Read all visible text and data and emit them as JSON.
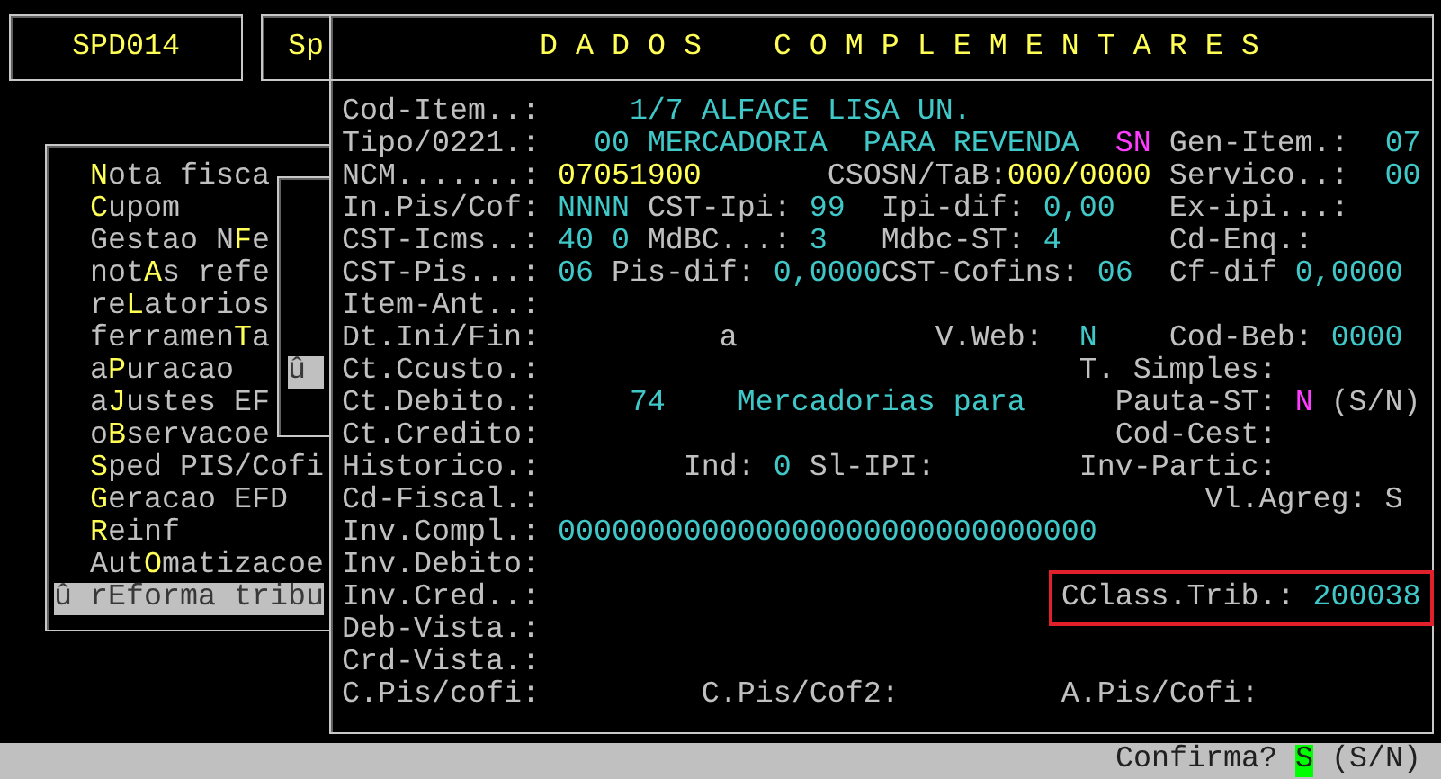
{
  "tabs": [
    {
      "label": "SPD014"
    },
    {
      "label": "Sp"
    }
  ],
  "menu": {
    "items": [
      {
        "hotkey": "N",
        "after": "ota fisca",
        "selected": false
      },
      {
        "hotkey": "C",
        "after": "upom",
        "selected": false
      },
      {
        "hotkey_before": "Gestao N",
        "hotkey": "F",
        "after": "e",
        "selected": false
      },
      {
        "hotkey_before": "not",
        "hotkey": "A",
        "after": "s refe",
        "selected": false
      },
      {
        "hotkey_before": "re",
        "hotkey": "L",
        "after": "atorios",
        "selected": false
      },
      {
        "hotkey_before": "ferramen",
        "hotkey": "T",
        "after": "a",
        "selected": false
      },
      {
        "hotkey_before": "a",
        "hotkey": "P",
        "after": "uracao",
        "selected": false
      },
      {
        "hotkey_before": "a",
        "hotkey": "J",
        "after": "ustes EF",
        "selected": false
      },
      {
        "hotkey_before": "o",
        "hotkey": "B",
        "after": "servacoe",
        "selected": false
      },
      {
        "hotkey": "S",
        "after": "ped PIS/Cofi",
        "selected": false
      },
      {
        "hotkey": "G",
        "after": "eracao EFD",
        "selected": false
      },
      {
        "hotkey": "R",
        "after": "einf",
        "selected": false
      },
      {
        "hotkey_before": "Aut",
        "hotkey": "O",
        "after": "matizacoe",
        "selected": false
      },
      {
        "marker": "û",
        "hotkey_before": "r",
        "hotkey": "E",
        "after": "forma tribu",
        "selected": true
      }
    ]
  },
  "submenu": {
    "marker": "û"
  },
  "dialog": {
    "title": "D A D O S    C O M P L E M E N T A R E S",
    "lines": [
      {
        "segments": [
          {
            "text": "Cod-Item..:",
            "color": "#c0c0c0"
          },
          {
            "text": "     1/7 ALFACE LISA UN.",
            "color": "#40c8c8"
          }
        ]
      },
      {
        "segments": [
          {
            "text": "Tipo/0221.:",
            "color": "#c0c0c0"
          },
          {
            "text": "   00 MERCADORIA  PARA REVENDA",
            "color": "#40c8c8"
          },
          {
            "text": "  SN",
            "color": "#ff3cff"
          },
          {
            "text": " Gen-Item.:",
            "color": "#c0c0c0"
          },
          {
            "text": "  07",
            "color": "#40c8c8"
          }
        ]
      },
      {
        "segments": [
          {
            "text": "NCM.......:",
            "color": "#c0c0c0"
          },
          {
            "text": " 07051900",
            "color": "#ffff55"
          },
          {
            "text": "       CSOSN/TaB:",
            "color": "#c0c0c0"
          },
          {
            "text": "000/0000",
            "color": "#ffff55"
          },
          {
            "text": " Servico..:",
            "color": "#c0c0c0"
          },
          {
            "text": "  00",
            "color": "#40c8c8"
          }
        ]
      },
      {
        "segments": [
          {
            "text": "In.Pis/Cof:",
            "color": "#c0c0c0"
          },
          {
            "text": " NNNN",
            "color": "#40c8c8"
          },
          {
            "text": " CST-Ipi:",
            "color": "#c0c0c0"
          },
          {
            "text": " 99",
            "color": "#40c8c8"
          },
          {
            "text": "  Ipi-dif:",
            "color": "#c0c0c0"
          },
          {
            "text": " 0,00",
            "color": "#40c8c8"
          },
          {
            "text": "   Ex-ipi...:",
            "color": "#c0c0c0"
          }
        ]
      },
      {
        "segments": [
          {
            "text": "CST-Icms..:",
            "color": "#c0c0c0"
          },
          {
            "text": " 40 0",
            "color": "#40c8c8"
          },
          {
            "text": " MdBC...:",
            "color": "#c0c0c0"
          },
          {
            "text": " 3",
            "color": "#40c8c8"
          },
          {
            "text": "   Mdbc-ST:",
            "color": "#c0c0c0"
          },
          {
            "text": " 4",
            "color": "#40c8c8"
          },
          {
            "text": "      Cd-Enq.:",
            "color": "#c0c0c0"
          }
        ]
      },
      {
        "segments": [
          {
            "text": "CST-Pis...:",
            "color": "#c0c0c0"
          },
          {
            "text": " 06",
            "color": "#40c8c8"
          },
          {
            "text": " Pis-dif:",
            "color": "#c0c0c0"
          },
          {
            "text": " 0,0000",
            "color": "#40c8c8"
          },
          {
            "text": "CST-Cofins:",
            "color": "#c0c0c0"
          },
          {
            "text": " 06",
            "color": "#40c8c8"
          },
          {
            "text": "  Cf-dif",
            "color": "#c0c0c0"
          },
          {
            "text": " 0,0000",
            "color": "#40c8c8"
          }
        ]
      },
      {
        "segments": [
          {
            "text": "Item-Ant..:",
            "color": "#c0c0c0"
          }
        ]
      },
      {
        "segments": [
          {
            "text": "Dt.Ini/Fin:",
            "color": "#c0c0c0"
          },
          {
            "text": "          a",
            "color": "#c0c0c0"
          },
          {
            "text": "           V.Web:",
            "color": "#c0c0c0"
          },
          {
            "text": "  N",
            "color": "#40c8c8"
          },
          {
            "text": "    Cod-Beb:",
            "color": "#c0c0c0"
          },
          {
            "text": " 0000",
            "color": "#40c8c8"
          }
        ]
      },
      {
        "segments": [
          {
            "text": "Ct.Ccusto.:",
            "color": "#c0c0c0"
          },
          {
            "text": "                              T. Simples:",
            "color": "#c0c0c0"
          }
        ]
      },
      {
        "segments": [
          {
            "text": "Ct.Debito.:",
            "color": "#c0c0c0"
          },
          {
            "text": "     74",
            "color": "#40c8c8"
          },
          {
            "text": "    Mercadorias para",
            "color": "#40c8c8"
          },
          {
            "text": "     Pauta-ST:",
            "color": "#c0c0c0"
          },
          {
            "text": " N",
            "color": "#ff3cff"
          },
          {
            "text": " (S/N)",
            "color": "#c0c0c0"
          }
        ]
      },
      {
        "segments": [
          {
            "text": "Ct.Credito:",
            "color": "#c0c0c0"
          },
          {
            "text": "                                Cod-Cest:",
            "color": "#c0c0c0"
          }
        ]
      },
      {
        "segments": [
          {
            "text": "Historico.:",
            "color": "#c0c0c0"
          },
          {
            "text": "        Ind:",
            "color": "#c0c0c0"
          },
          {
            "text": " 0",
            "color": "#40c8c8"
          },
          {
            "text": " Sl-IPI:",
            "color": "#c0c0c0"
          },
          {
            "text": "        Inv-Partic:",
            "color": "#c0c0c0"
          }
        ]
      },
      {
        "segments": [
          {
            "text": "Cd-Fiscal.:",
            "color": "#c0c0c0"
          },
          {
            "text": "                                     Vl.Agreg:",
            "color": "#c0c0c0"
          },
          {
            "text": " S",
            "color": "#c0c0c0"
          }
        ]
      },
      {
        "segments": [
          {
            "text": "Inv.Compl.:",
            "color": "#c0c0c0"
          },
          {
            "text": " 000000000000000000000000000000",
            "color": "#40c8c8"
          }
        ]
      },
      {
        "segments": [
          {
            "text": "Inv.Debito:",
            "color": "#c0c0c0"
          }
        ]
      },
      {
        "segments": [
          {
            "text": "Inv.Cred..:",
            "color": "#c0c0c0"
          },
          {
            "outlined": true,
            "parts": [
              {
                "text": "                             CClass.Trib.:",
                "color": "#c0c0c0"
              },
              {
                "text": " 200038",
                "color": "#40c8c8"
              }
            ]
          }
        ]
      },
      {
        "segments": [
          {
            "text": "Deb-Vista.:",
            "color": "#c0c0c0"
          }
        ]
      },
      {
        "segments": [
          {
            "text": "Crd-Vista.:",
            "color": "#c0c0c0"
          }
        ]
      },
      {
        "segments": [
          {
            "text": "C.Pis/cofi:",
            "color": "#c0c0c0"
          },
          {
            "text": "         C.Pis/Cof2:",
            "color": "#c0c0c0"
          },
          {
            "text": "         A.Pis/Cofi:",
            "color": "#c0c0c0"
          }
        ]
      }
    ]
  },
  "status_bar": {
    "prompt": "Confirma?",
    "answer": "S",
    "options": "(S/N)"
  }
}
